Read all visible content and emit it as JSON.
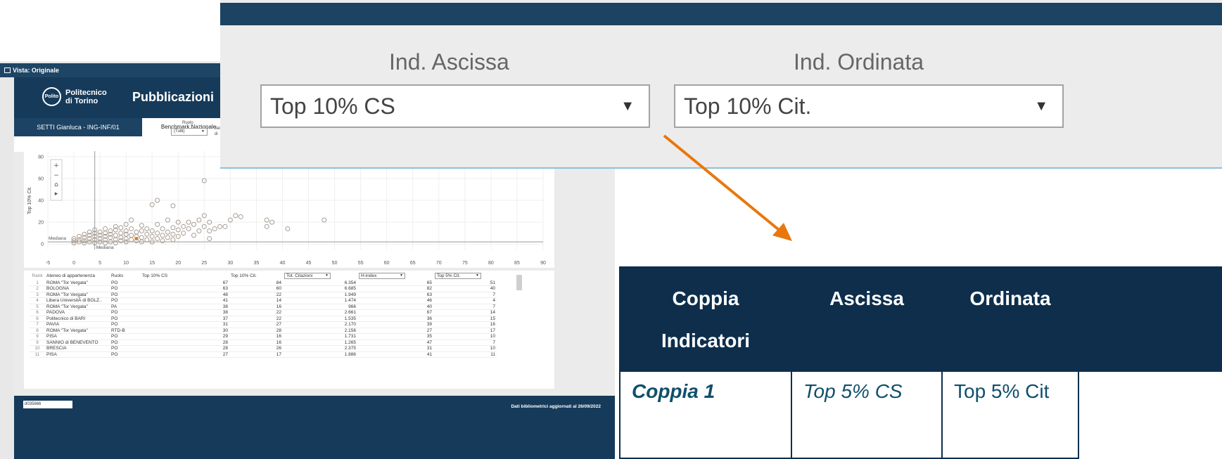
{
  "dashboard": {
    "vista_label": "Vista: Originale",
    "logo_text": "Politecnico di Torino",
    "logo_seal": "Polito",
    "title": "Pubblicazioni",
    "user_tab": "SETTI Gianluca - ING-INF/01",
    "active_tab": "Benchmark Nazionale",
    "ruolo_label": "Ruolo",
    "ruolo_value": "(Tutti)",
    "sel_label": "Sel di",
    "user_id": "d035666",
    "footer_note": "Dati bibliometrici aggiornati al 26/09/2022"
  },
  "chart_data": {
    "type": "scatter",
    "ylabel": "Top 10% Cit.",
    "xlabel": "",
    "xlim": [
      -5,
      90
    ],
    "ylim": [
      -5,
      85
    ],
    "x_ticks": [
      -5,
      0,
      5,
      10,
      15,
      20,
      25,
      30,
      35,
      40,
      45,
      50,
      55,
      60,
      65,
      70,
      75,
      80,
      85,
      90
    ],
    "y_ticks": [
      0,
      20,
      40,
      60,
      80
    ],
    "reference_lines": [
      {
        "axis": "y",
        "label": "Mediana",
        "value": 2
      },
      {
        "axis": "x",
        "label": "Mediana",
        "value": 4
      }
    ],
    "highlight_point": {
      "x": 12,
      "y": 5,
      "color": "#e08020"
    },
    "points": [
      [
        0,
        1
      ],
      [
        0,
        3
      ],
      [
        0,
        5
      ],
      [
        1,
        2
      ],
      [
        1,
        4
      ],
      [
        1,
        7
      ],
      [
        2,
        1
      ],
      [
        2,
        3
      ],
      [
        2,
        6
      ],
      [
        2,
        9
      ],
      [
        3,
        2
      ],
      [
        3,
        5
      ],
      [
        3,
        8
      ],
      [
        3,
        11
      ],
      [
        4,
        1
      ],
      [
        4,
        4
      ],
      [
        4,
        7
      ],
      [
        4,
        10
      ],
      [
        4,
        13
      ],
      [
        5,
        2
      ],
      [
        5,
        5
      ],
      [
        5,
        8
      ],
      [
        5,
        11
      ],
      [
        6,
        1
      ],
      [
        6,
        4
      ],
      [
        6,
        7
      ],
      [
        6,
        10
      ],
      [
        6,
        14
      ],
      [
        7,
        2
      ],
      [
        7,
        6
      ],
      [
        7,
        9
      ],
      [
        7,
        12
      ],
      [
        8,
        1
      ],
      [
        8,
        4
      ],
      [
        8,
        8
      ],
      [
        8,
        13
      ],
      [
        8,
        16
      ],
      [
        9,
        3
      ],
      [
        9,
        6
      ],
      [
        9,
        10
      ],
      [
        9,
        15
      ],
      [
        10,
        2
      ],
      [
        10,
        5
      ],
      [
        10,
        9
      ],
      [
        10,
        12
      ],
      [
        10,
        18
      ],
      [
        11,
        4
      ],
      [
        11,
        8
      ],
      [
        11,
        14
      ],
      [
        11,
        22
      ],
      [
        12,
        3
      ],
      [
        12,
        7
      ],
      [
        12,
        11
      ],
      [
        13,
        2
      ],
      [
        13,
        6
      ],
      [
        13,
        12
      ],
      [
        13,
        17
      ],
      [
        14,
        4
      ],
      [
        14,
        9
      ],
      [
        14,
        14
      ],
      [
        15,
        2
      ],
      [
        15,
        7
      ],
      [
        15,
        12
      ],
      [
        15,
        36
      ],
      [
        16,
        5
      ],
      [
        16,
        10
      ],
      [
        16,
        18
      ],
      [
        16,
        40
      ],
      [
        17,
        3
      ],
      [
        17,
        8
      ],
      [
        17,
        14
      ],
      [
        18,
        6
      ],
      [
        18,
        11
      ],
      [
        18,
        22
      ],
      [
        19,
        4
      ],
      [
        19,
        9
      ],
      [
        19,
        15
      ],
      [
        19,
        35
      ],
      [
        20,
        7
      ],
      [
        20,
        13
      ],
      [
        20,
        20
      ],
      [
        21,
        10
      ],
      [
        21,
        16
      ],
      [
        22,
        14
      ],
      [
        22,
        20
      ],
      [
        23,
        8
      ],
      [
        23,
        18
      ],
      [
        24,
        12
      ],
      [
        24,
        22
      ],
      [
        25,
        16
      ],
      [
        25,
        26
      ],
      [
        25,
        58
      ],
      [
        26,
        5
      ],
      [
        26,
        12
      ],
      [
        26,
        20
      ],
      [
        27,
        14
      ],
      [
        28,
        16
      ],
      [
        29,
        16
      ],
      [
        30,
        22
      ],
      [
        31,
        26
      ],
      [
        32,
        25
      ],
      [
        37,
        16
      ],
      [
        37,
        22
      ],
      [
        38,
        20
      ],
      [
        41,
        14
      ],
      [
        48,
        22
      ]
    ]
  },
  "ranking_table": {
    "headers": {
      "rank": "Rank",
      "ateneo": "Ateneo di appartenenza",
      "ruolo": "Ruolo",
      "cs": "Top 10% CS",
      "cit": "Top 10% Cit.",
      "sel1": "Tot. Citazioni",
      "sel2": "H-index",
      "sel3": "Top 5% Cit."
    },
    "rows": [
      {
        "rank": "1",
        "ateneo": "ROMA \"Tor Vergata\"",
        "ruolo": "PO",
        "cs": "67",
        "cit": "84",
        "v1": "6.354",
        "v2": "65",
        "v3": "51"
      },
      {
        "rank": "2",
        "ateneo": "BOLOGNA",
        "ruolo": "PO",
        "cs": "63",
        "cit": "60",
        "v1": "6.685",
        "v2": "82",
        "v3": "40"
      },
      {
        "rank": "3",
        "ateneo": "ROMA \"Tor Vergata\"",
        "ruolo": "PO",
        "cs": "48",
        "cit": "22",
        "v1": "1.949",
        "v2": "63",
        "v3": "7"
      },
      {
        "rank": "4",
        "ateneo": "Libera UniversitÃ  di BOLZ..",
        "ruolo": "PO",
        "cs": "41",
        "cit": "14",
        "v1": "1.474",
        "v2": "46",
        "v3": "4"
      },
      {
        "rank": "5",
        "ateneo": "ROMA \"Tor Vergata\"",
        "ruolo": "PA",
        "cs": "38",
        "cit": "16",
        "v1": "966",
        "v2": "40",
        "v3": "7"
      },
      {
        "rank": "6",
        "ateneo": "PADOVA",
        "ruolo": "PO",
        "cs": "38",
        "cit": "22",
        "v1": "2.661",
        "v2": "67",
        "v3": "14"
      },
      {
        "rank": "6",
        "ateneo": "Politecnico di BARI",
        "ruolo": "PO",
        "cs": "37",
        "cit": "22",
        "v1": "1.535",
        "v2": "36",
        "v3": "15"
      },
      {
        "rank": "7",
        "ateneo": "PAVIA",
        "ruolo": "PO",
        "cs": "31",
        "cit": "27",
        "v1": "2.170",
        "v2": "39",
        "v3": "16"
      },
      {
        "rank": "8",
        "ateneo": "ROMA \"Tor Vergata\"",
        "ruolo": "RTD-B",
        "cs": "30",
        "cit": "28",
        "v1": "2.156",
        "v2": "27",
        "v3": "17"
      },
      {
        "rank": "9",
        "ateneo": "PISA",
        "ruolo": "PO",
        "cs": "29",
        "cit": "16",
        "v1": "1.731",
        "v2": "35",
        "v3": "10"
      },
      {
        "rank": "9",
        "ateneo": "SANNIO di BENEVENTO",
        "ruolo": "PO",
        "cs": "28",
        "cit": "16",
        "v1": "1.265",
        "v2": "47",
        "v3": "7"
      },
      {
        "rank": "10",
        "ateneo": "BRESCIA",
        "ruolo": "PO",
        "cs": "28",
        "cit": "26",
        "v1": "2.375",
        "v2": "31",
        "v3": "10"
      },
      {
        "rank": "11",
        "ateneo": "PISA",
        "ruolo": "PO",
        "cs": "27",
        "cit": "17",
        "v1": "1.886",
        "v2": "41",
        "v3": "11"
      }
    ]
  },
  "zoom_filters": {
    "x_label": "Ind. Ascissa",
    "x_value": "Top 10% CS",
    "y_label": "Ind. Ordinata",
    "y_value": "Top 10% Cit.",
    "arrow_glyph": "▼"
  },
  "pair_table": {
    "headers": {
      "c1_line1": "Coppia",
      "c1_line2": "Indicatori",
      "c2": "Ascissa",
      "c3": "Ordinata"
    },
    "rows": [
      {
        "pair": "Coppia 1",
        "ascissa": "Top 5% CS",
        "ordinata": "Top 5% Cit"
      }
    ]
  },
  "colors": {
    "navy": "#163a5a",
    "arrow": "#e8780d",
    "highlight": "#e08020"
  }
}
